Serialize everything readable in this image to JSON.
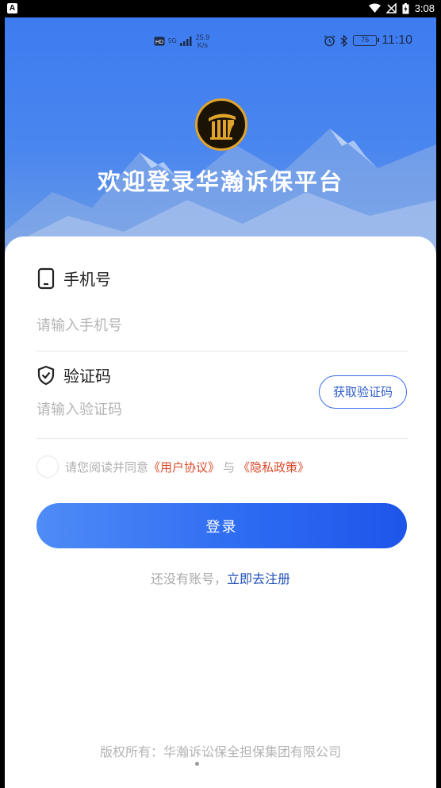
{
  "system_status": {
    "badge": "A",
    "time": "3:08",
    "icons": [
      "wifi-icon",
      "signal-off-icon",
      "battery-charging-icon"
    ]
  },
  "app_status": {
    "network_type": "5G",
    "speed_value": "25.9",
    "speed_unit": "K/s",
    "battery_level": "76",
    "clock": "11:10"
  },
  "header": {
    "welcome_title": "欢迎登录华瀚诉保平台"
  },
  "form": {
    "phone_label": "手机号",
    "phone_placeholder": "请输入手机号",
    "phone_value": "",
    "code_label": "验证码",
    "code_placeholder": "请输入验证码",
    "code_value": "",
    "get_code_label": "获取验证码"
  },
  "agreement": {
    "prefix": "请您阅读并同意",
    "user_agreement": "《用户协议》",
    "connector": "与",
    "privacy_policy": "《隐私政策》",
    "checked": false
  },
  "actions": {
    "login_label": "登录",
    "register_hint": "还没有账号，",
    "register_link": "立即去注册"
  },
  "footer": {
    "copyright": "版权所有：华瀚诉讼保全担保集团有限公司"
  },
  "colors": {
    "primary": "#2e6cf2",
    "link_red": "#d84a2b",
    "logo_gold": "#e0a42c"
  }
}
